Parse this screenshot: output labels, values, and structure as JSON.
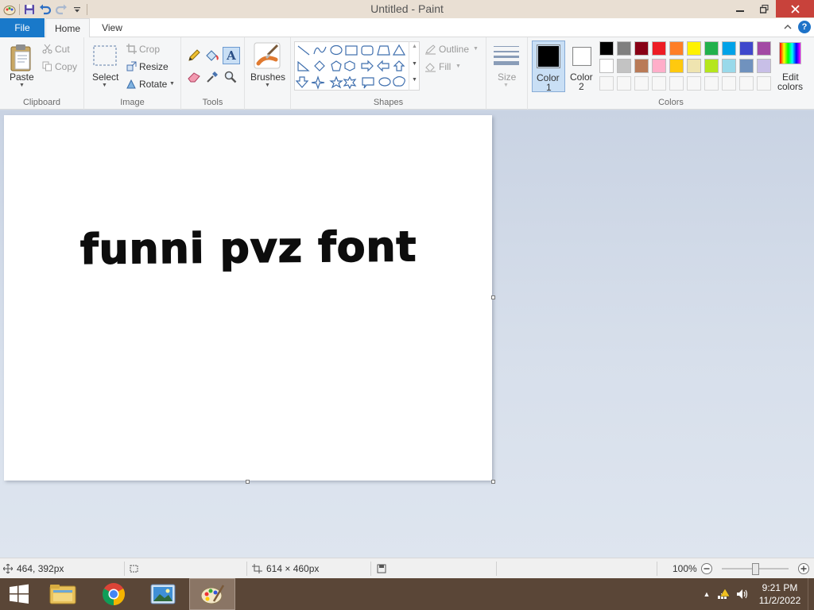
{
  "window": {
    "title": "Untitled - Paint"
  },
  "tabs": {
    "file": "File",
    "home": "Home",
    "view": "View"
  },
  "help": {
    "label": "?"
  },
  "ribbon": {
    "clipboard": {
      "label": "Clipboard",
      "paste": "Paste",
      "cut": "Cut",
      "copy": "Copy"
    },
    "image": {
      "label": "Image",
      "select": "Select",
      "crop": "Crop",
      "resize": "Resize",
      "rotate": "Rotate"
    },
    "tools": {
      "label": "Tools",
      "text_tool_glyph": "A"
    },
    "brushes": {
      "label": "Brushes"
    },
    "shapes": {
      "label": "Shapes",
      "outline": "Outline",
      "fill": "Fill"
    },
    "size": {
      "label": "Size"
    },
    "color1": {
      "label": "Color",
      "number": "1",
      "value": "#000000"
    },
    "color2": {
      "label": "Color",
      "number": "2",
      "value": "#ffffff"
    },
    "colors": {
      "label": "Colors",
      "row1": [
        "#000000",
        "#7f7f7f",
        "#880015",
        "#ed1c24",
        "#ff7f27",
        "#fff200",
        "#22b14c",
        "#00a2e8",
        "#3f48cc",
        "#a349a4"
      ],
      "row2": [
        "#ffffff",
        "#c3c3c3",
        "#b97a57",
        "#ffaec9",
        "#ffc90e",
        "#efe4b0",
        "#b5e61d",
        "#99d9ea",
        "#7092be",
        "#c8bfe7"
      ],
      "edit_line1": "Edit",
      "edit_line2": "colors"
    }
  },
  "canvas": {
    "text": "funni pvz font"
  },
  "status": {
    "cursor_pos": "464, 392px",
    "canvas_size": "614 × 460px",
    "zoom": "100%"
  },
  "taskbar": {
    "time": "9:21 PM",
    "date": "11/2/2022"
  }
}
